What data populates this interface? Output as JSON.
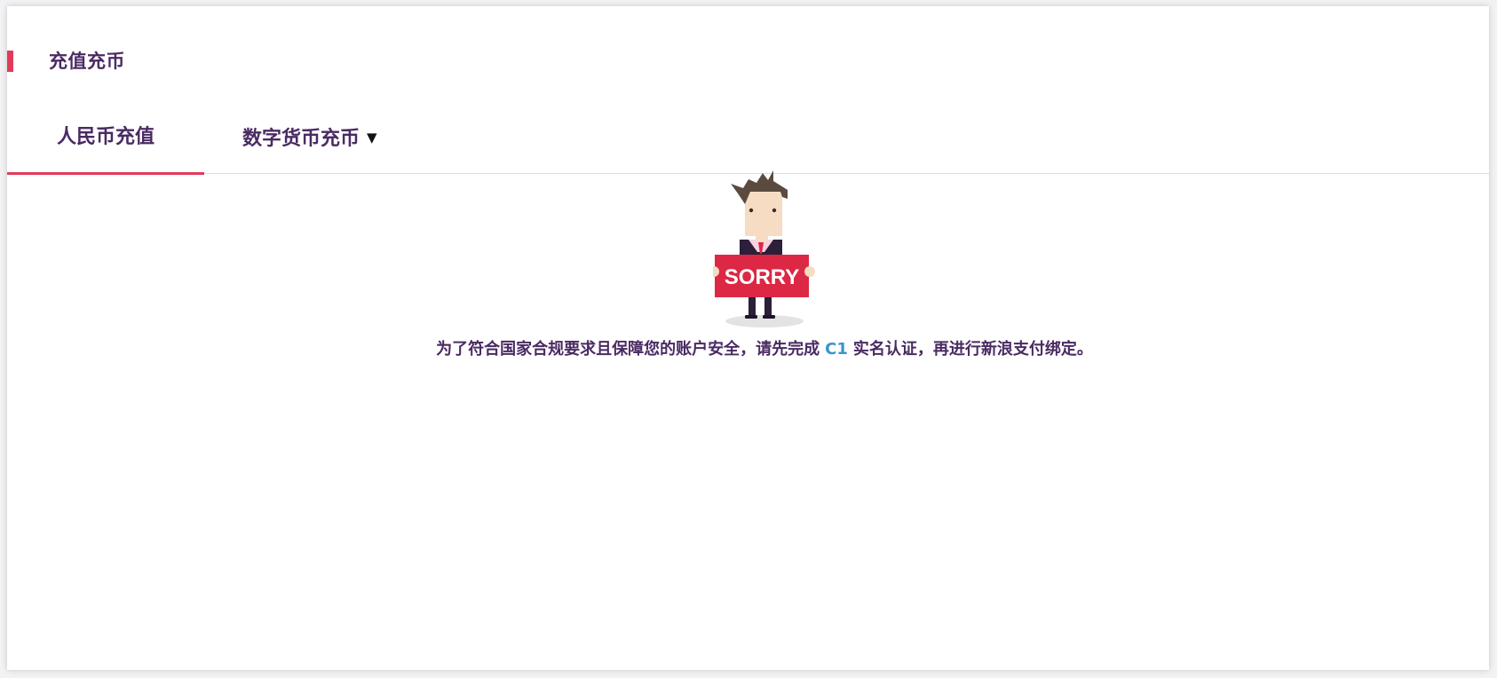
{
  "section": {
    "title": "充值充币"
  },
  "tabs": [
    {
      "label": "人民币充值",
      "active": true
    },
    {
      "label": "数字货币充币",
      "has_dropdown": true,
      "dropdown_icon": "caret-down-icon"
    }
  ],
  "illustration": {
    "sign_text": "SORRY",
    "icon": "sorry-man-illustration"
  },
  "notice": {
    "before": "为了符合国家合规要求且保障您的账户安全，请先完成",
    "level": "C1",
    "after": "实名认证，再进行新浪支付绑定。"
  },
  "colors": {
    "accent": "#e23b5a",
    "text_primary": "#4a2a63",
    "link": "#3b93c9",
    "sign_red": "#dc2844"
  }
}
